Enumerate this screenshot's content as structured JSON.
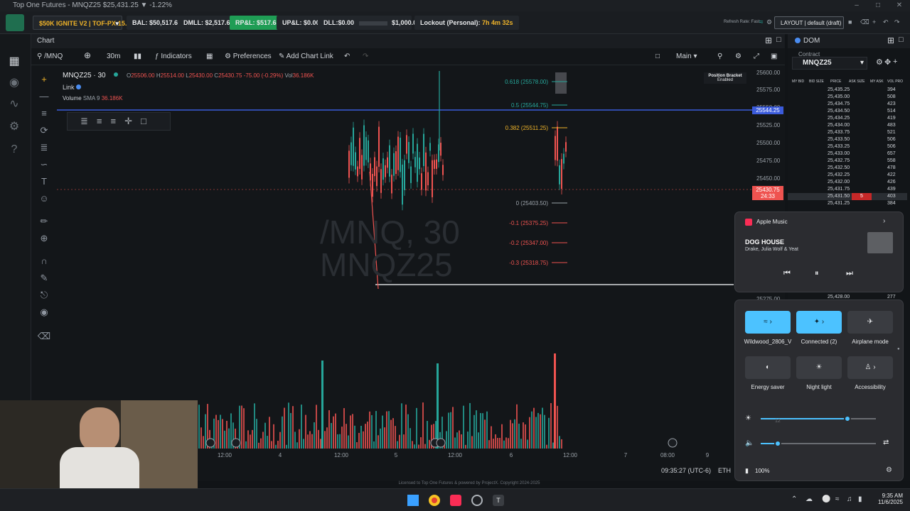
{
  "window": {
    "title": "Top One Futures - MNQZ25 $25,431.25 ▼ -1.22%"
  },
  "topbar": {
    "account": "$50K IGNITE V2 | TOF-PX-15...",
    "bal": "BAL: $50,517.68",
    "dmll": "DMLL: $2,517.68",
    "rpl": "RP&L: $517.68",
    "upl": "UP&L: $0.00",
    "dll": "DLL:$0.00",
    "dll_limit": "$1,000.00",
    "lockout": "Lockout (Personal):",
    "lockout_time": "7h 4m 32s",
    "refresh": "Refresh Rate: Fast",
    "layout": "LAYOUT | default (draft)",
    "colors": {
      "rpl": "#1f9d55",
      "lockout_time": "#f0b429"
    }
  },
  "chart": {
    "tab": "Chart",
    "symbol": "/MNQ",
    "interval": "30m",
    "indicators": "Indicators",
    "preferences": "Preferences",
    "add_chart_link": "Add Chart Link",
    "main": "Main",
    "legend_title": "MNQZ25 · 30",
    "ohlc": {
      "o_label": "O",
      "o": "25506.00",
      "h_label": "H",
      "h": "25514.00",
      "l_label": "L",
      "l": "25430.00",
      "c_label": "C",
      "c": "25430.75",
      "change": "-75.00 (-0.29%)",
      "vol_label": "Vol",
      "vol": "36.186K"
    },
    "link": "Link",
    "volume_label": "Volume",
    "sma_label": "SMA 9",
    "sma_value": "36.186K",
    "watermark_line1": "/MNQ, 30",
    "watermark_line2": "MNQZ25",
    "position_bracket": "Position Bracket",
    "position_bracket_state": "Enabled",
    "fib_labels": [
      "0.618 (25578.00)",
      "0.5 (25544.75)",
      "0.382 (25511.25)",
      "0 (25403.50)",
      "-0.1 (25375.25)",
      "-0.2 (25347.00)",
      "-0.3 (25318.75)"
    ],
    "y_ticks": [
      "25600.00",
      "25575.00",
      "25550.00",
      "25525.00",
      "25500.00",
      "25475.00",
      "25450.00",
      "25275.00"
    ],
    "blue_line_price": "25544.25",
    "last_price": "25430.75",
    "last_price_timer": "24:33",
    "x_ticks": [
      "12:00",
      "4",
      "12:00",
      "5",
      "12:00",
      "6",
      "12:00",
      "7",
      "08:00",
      "9"
    ],
    "time": "09:35:27 (UTC-6)",
    "session": "ETH",
    "license": "Licensed to Top One Futures & powered by ProjectX. Copyright 2024-2025",
    "colors": {
      "up": "#26a69a",
      "down": "#ef5350",
      "blue_line": "#3b5bdb"
    }
  },
  "dom": {
    "tab": "DOM",
    "contract_label": "Contract",
    "contract": "MNQZ25",
    "headers": [
      "MY BID",
      "BID SIZE",
      "PRICE",
      "ASK SIZE",
      "MY ASK",
      "VOL PRO"
    ],
    "rows": [
      {
        "price": "25,435.25",
        "vol": "394"
      },
      {
        "price": "25,435.00",
        "vol": "508"
      },
      {
        "price": "25,434.75",
        "vol": "423"
      },
      {
        "price": "25,434.50",
        "vol": "514"
      },
      {
        "price": "25,434.25",
        "vol": "419"
      },
      {
        "price": "25,434.00",
        "vol": "483"
      },
      {
        "price": "25,433.75",
        "vol": "521"
      },
      {
        "price": "25,433.50",
        "vol": "506"
      },
      {
        "price": "25,433.25",
        "vol": "506"
      },
      {
        "price": "25,433.00",
        "vol": "657"
      },
      {
        "price": "25,432.75",
        "vol": "558"
      },
      {
        "price": "25,432.50",
        "vol": "478"
      },
      {
        "price": "25,432.25",
        "vol": "422"
      },
      {
        "price": "25,432.00",
        "vol": "426"
      },
      {
        "price": "25,431.75",
        "vol": "439"
      },
      {
        "price": "25,431.50",
        "vol": "403"
      },
      {
        "price": "25,431.25",
        "vol": "384"
      }
    ],
    "ask_highlight": "5",
    "bottom_price": "25,428.00",
    "bottom_vol": "277"
  },
  "music": {
    "app": "Apple Music",
    "track": "DOG HOUSE",
    "artists": "Drake, Julia Wolf & Yeat"
  },
  "quick": {
    "wifi_label": "Wildwood_2806_V",
    "bt_label": "Connected (2)",
    "airplane_label": "Airplane mode",
    "energy_label": "Energy saver",
    "night_label": "Night light",
    "access_label": "Accessibility",
    "brightness_tooltip": "12",
    "brightness_level": 0.75,
    "volume_level": 0.15,
    "battery": "100%"
  },
  "taskbar": {
    "time": "9:35 AM",
    "date": "11/6/2025"
  }
}
